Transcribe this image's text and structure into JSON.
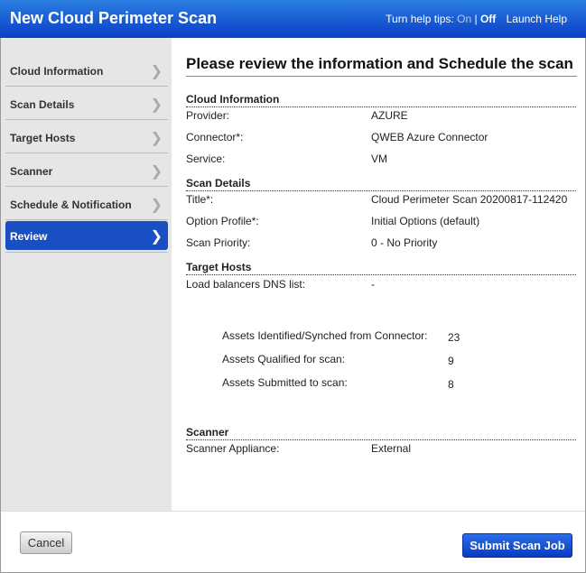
{
  "header": {
    "title": "New Cloud Perimeter Scan",
    "help_prefix": "Turn help tips:",
    "help_on": "On",
    "help_sep": "|",
    "help_off": "Off",
    "launch_help": "Launch Help"
  },
  "sidebar": {
    "items": [
      {
        "label": "Cloud Information"
      },
      {
        "label": "Scan Details"
      },
      {
        "label": "Target Hosts"
      },
      {
        "label": "Scanner"
      },
      {
        "label": "Schedule & Notification"
      },
      {
        "label": "Review"
      }
    ]
  },
  "main": {
    "heading": "Please review the information and Schedule the scan",
    "cloud": {
      "title": "Cloud Information",
      "rows": [
        {
          "label": "Provider:",
          "value": "AZURE"
        },
        {
          "label": "Connector*:",
          "value": "QWEB Azure Connector"
        },
        {
          "label": "Service:",
          "value": "VM"
        }
      ]
    },
    "scan": {
      "title": "Scan Details",
      "rows": [
        {
          "label": "Title*:",
          "value": "Cloud Perimeter Scan 20200817-112420"
        },
        {
          "label": "Option Profile*:",
          "value": "Initial Options (default)"
        },
        {
          "label": "Scan Priority:",
          "value": "0 - No Priority"
        }
      ]
    },
    "targets": {
      "title": "Target Hosts",
      "lb_label": "Load balancers DNS list:",
      "lb_value": "-",
      "assets": [
        {
          "label": "Assets Identified/Synched from Connector:",
          "value": "23"
        },
        {
          "label": "Assets Qualified for scan:",
          "value": "9"
        },
        {
          "label": "Assets Submitted to scan:",
          "value": "8"
        }
      ]
    },
    "scanner": {
      "title": "Scanner",
      "label": "Scanner Appliance:",
      "value": "External"
    }
  },
  "footer": {
    "cancel": "Cancel",
    "submit": "Submit Scan Job"
  }
}
